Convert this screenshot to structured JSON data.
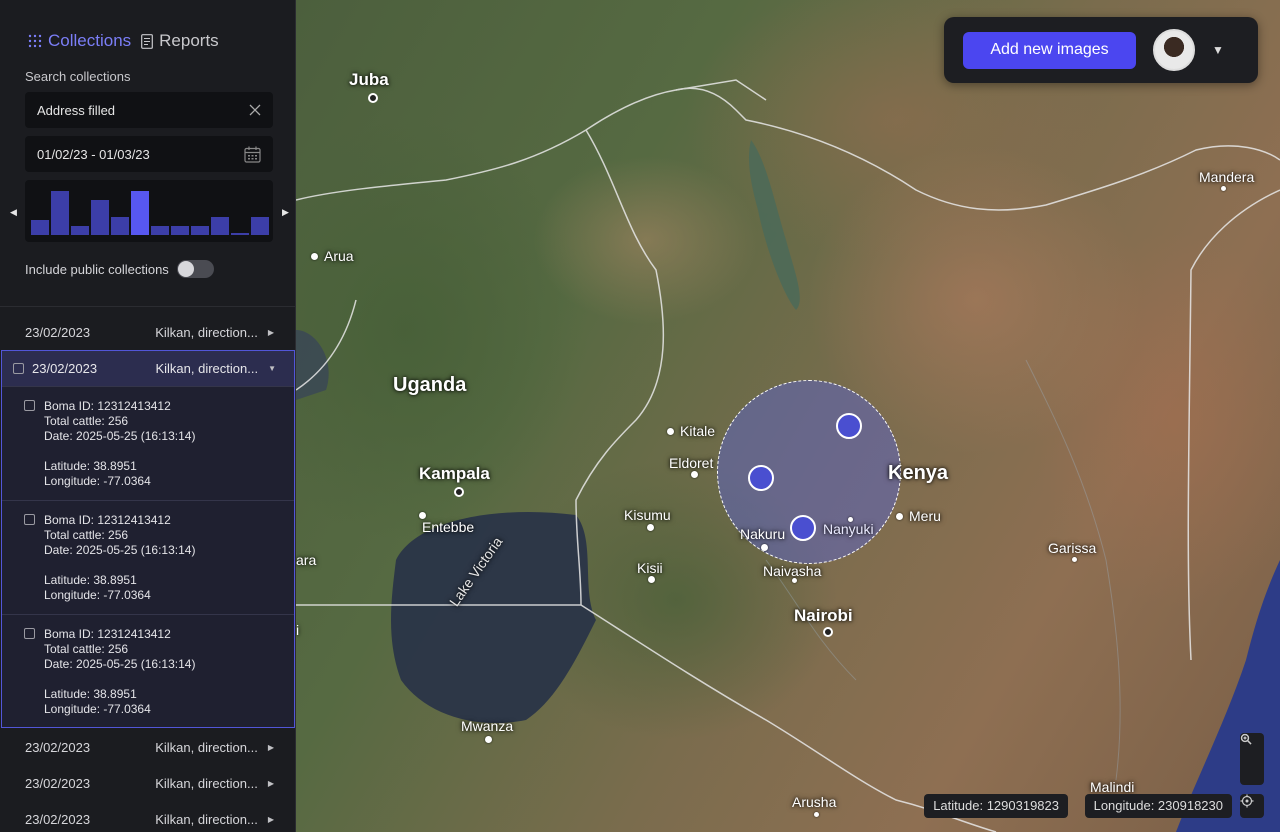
{
  "sidebar": {
    "tabs": [
      {
        "label": "Collections",
        "icon": "grid-icon",
        "active": true
      },
      {
        "label": "Reports",
        "icon": "document-icon",
        "active": false
      }
    ],
    "search_label": "Search collections",
    "search_value": "Address filled",
    "date_range": "01/02/23 - 01/03/23",
    "histogram": [
      0.35,
      1.0,
      0.2,
      0.8,
      0.4,
      1.0,
      0.2,
      0.2,
      0.2,
      0.4,
      0.05,
      0.4
    ],
    "include_public_label": "Include public collections",
    "include_public_on": false,
    "rows_top": [
      {
        "date": "23/02/2023",
        "name": "Kilkan, direction..."
      }
    ],
    "expanded": {
      "date": "23/02/2023",
      "name": "Kilkan, direction...",
      "entries": [
        {
          "boma": "Boma ID: 12312413412",
          "cattle": "Total cattle: 256",
          "date": "Date: 2025-05-25 (16:13:14)",
          "lat": "Latitude: 38.8951",
          "lon": "Longitude: -77.0364"
        },
        {
          "boma": "Boma ID: 12312413412",
          "cattle": "Total cattle: 256",
          "date": "Date: 2025-05-25 (16:13:14)",
          "lat": "Latitude: 38.8951",
          "lon": "Longitude: -77.0364"
        },
        {
          "boma": "Boma ID: 12312413412",
          "cattle": "Total cattle: 256",
          "date": "Date: 2025-05-25 (16:13:14)",
          "lat": "Latitude: 38.8951",
          "lon": "Longitude: -77.0364"
        }
      ]
    },
    "rows_bottom": [
      {
        "date": "23/02/2023",
        "name": "Kilkan, direction..."
      },
      {
        "date": "23/02/2023",
        "name": "Kilkan, direction..."
      },
      {
        "date": "23/02/2023",
        "name": "Kilkan, direction..."
      }
    ]
  },
  "header": {
    "add_button": "Add new images"
  },
  "map": {
    "places": [
      {
        "name": "Juba",
        "size": "med"
      },
      {
        "name": "Arua",
        "size": "small"
      },
      {
        "name": "Uganda",
        "size": "big"
      },
      {
        "name": "Kampala",
        "size": "med"
      },
      {
        "name": "Entebbe",
        "size": "small"
      },
      {
        "name": "Lake Victoria",
        "size": "small"
      },
      {
        "name": "Mwanza",
        "size": "small"
      },
      {
        "name": "Kitale",
        "size": "small"
      },
      {
        "name": "Eldoret",
        "size": "small"
      },
      {
        "name": "Kisumu",
        "size": "small"
      },
      {
        "name": "Kisii",
        "size": "small"
      },
      {
        "name": "Nakuru",
        "size": "small"
      },
      {
        "name": "Nanyuki",
        "size": "small"
      },
      {
        "name": "Naivasha",
        "size": "small"
      },
      {
        "name": "Nairobi",
        "size": "med"
      },
      {
        "name": "Kenya",
        "size": "big"
      },
      {
        "name": "Meru",
        "size": "small"
      },
      {
        "name": "Garissa",
        "size": "small"
      },
      {
        "name": "Mandera",
        "size": "small"
      },
      {
        "name": "Malindi",
        "size": "small"
      },
      {
        "name": "Arusha",
        "size": "small"
      },
      {
        "name": "ara",
        "size": "small"
      },
      {
        "name": "i",
        "size": "small"
      }
    ],
    "latitude": "Latitude: 1290319823",
    "longitude": "Longitude: 230918230"
  }
}
